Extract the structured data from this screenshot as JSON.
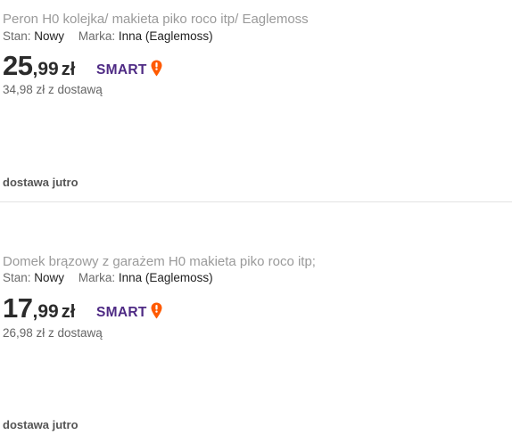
{
  "listings": [
    {
      "title": "Peron H0 kolejka/ makieta piko roco itp/ Eaglemoss",
      "condition_label": "Stan:",
      "condition_value": "Nowy",
      "brand_label": "Marka:",
      "brand_value": "Inna (Eaglemoss)",
      "price_int": "25",
      "price_dec": ",99",
      "currency": "zł",
      "smart_label": "SMART",
      "price_with_shipping": "34,98 zł z dostawą",
      "delivery": "dostawa jutro"
    },
    {
      "title": "Domek brązowy z garażem H0 makieta piko roco itp;",
      "condition_label": "Stan:",
      "condition_value": "Nowy",
      "brand_label": "Marka:",
      "brand_value": "Inna (Eaglemoss)",
      "price_int": "17",
      "price_dec": ",99",
      "currency": "zł",
      "smart_label": "SMART",
      "price_with_shipping": "26,98 zł z dostawą",
      "delivery": "dostawa jutro"
    }
  ],
  "colors": {
    "smart_text": "#4e2a84",
    "smart_pin": "#ff5a00",
    "title": "#9a9a9a",
    "price": "#2b2b2b"
  },
  "icons": {
    "smart_pin": "smart-pin-icon"
  }
}
